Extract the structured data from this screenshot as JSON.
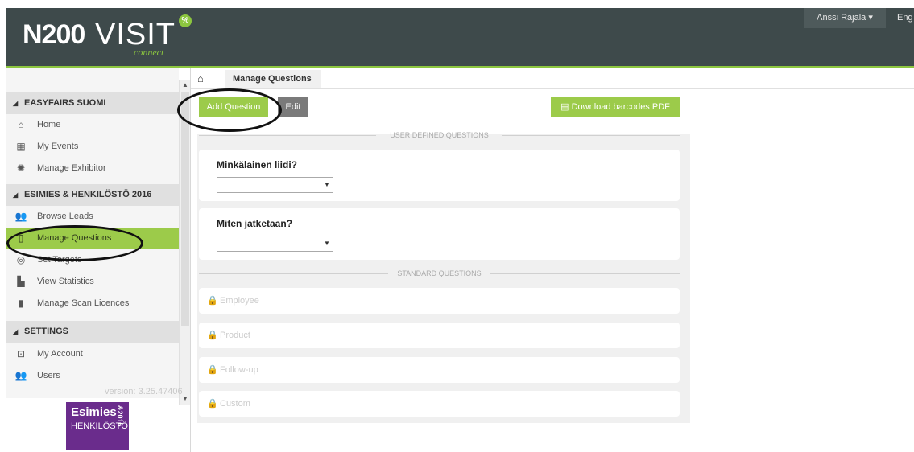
{
  "header": {
    "logo_n200": "N200",
    "logo_visit": "VISIT",
    "logo_connect": "connect",
    "user_menu": "Anssi Rajala ▾",
    "language": "Eng"
  },
  "breadcrumb": {
    "home_icon": "home-icon",
    "current": "Manage Questions"
  },
  "sidebar": {
    "sections": [
      {
        "label": "EASYFAIRS SUOMI"
      },
      {
        "label": "ESIMIES & HENKILÖSTÖ 2016"
      },
      {
        "label": "SETTINGS"
      }
    ],
    "items": [
      {
        "label": "Home",
        "icon": "home-icon"
      },
      {
        "label": "My Events",
        "icon": "calendar-icon"
      },
      {
        "label": "Manage Exhibitor",
        "icon": "settings-icon"
      },
      {
        "label": "Browse Leads",
        "icon": "users-icon"
      },
      {
        "label": "Manage Questions",
        "icon": "clipboard-icon",
        "active": true
      },
      {
        "label": "Set Targets",
        "icon": "target-icon"
      },
      {
        "label": "View Statistics",
        "icon": "bar-chart-icon"
      },
      {
        "label": "Manage Scan Licences",
        "icon": "phone-icon"
      },
      {
        "label": "My Account",
        "icon": "account-icon"
      },
      {
        "label": "Users",
        "icon": "users-icon"
      }
    ],
    "version": "version: 3.25.47406"
  },
  "event_logo": {
    "line1": "Esimies",
    "line2": "HENKILÖSTÖ",
    "side": "&2016"
  },
  "toolbar": {
    "add_question": "Add Question",
    "edit": "Edit",
    "download_pdf": "Download barcodes PDF"
  },
  "user_defined": {
    "heading": "USER DEFINED QUESTIONS",
    "questions": [
      {
        "title": "Minkälainen liidi?",
        "value": ""
      },
      {
        "title": "Miten jatketaan?",
        "value": ""
      }
    ]
  },
  "standard": {
    "heading": "STANDARD QUESTIONS",
    "items": [
      "Employee",
      "Product",
      "Follow-up",
      "Custom"
    ]
  },
  "colors": {
    "accent": "#9ccb4a",
    "header": "#3e4a4b",
    "active_nav": "#9ccb4a"
  }
}
